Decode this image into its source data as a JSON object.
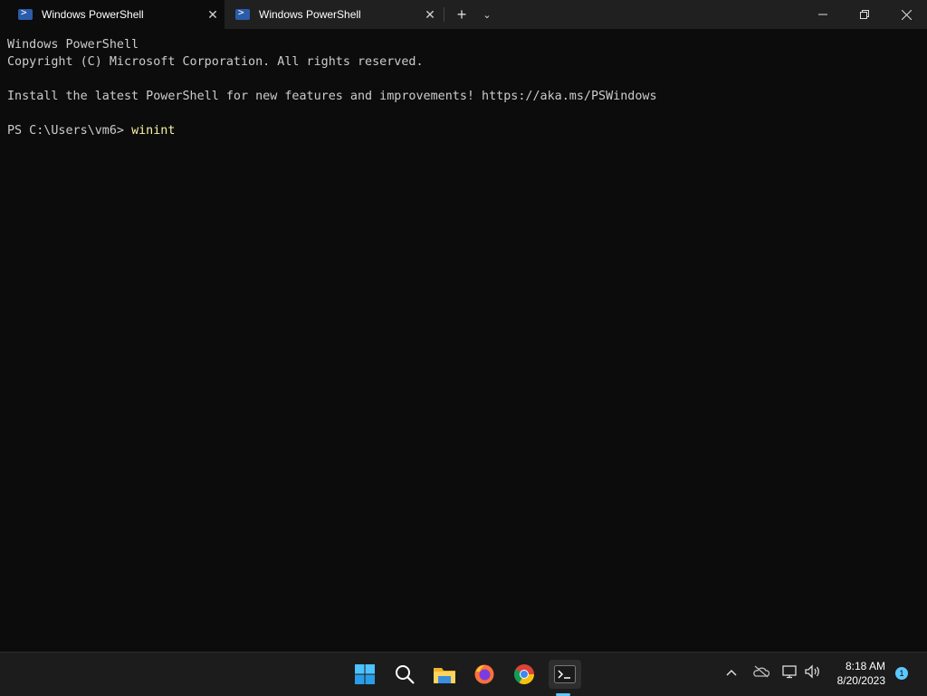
{
  "tabs": [
    {
      "label": "Windows PowerShell"
    },
    {
      "label": "Windows PowerShell"
    }
  ],
  "terminal": {
    "line1": "Windows PowerShell",
    "line2": "Copyright (C) Microsoft Corporation. All rights reserved.",
    "line3": "Install the latest PowerShell for new features and improvements! https://aka.ms/PSWindows",
    "prompt": "PS C:\\Users\\vm6> ",
    "command": "winint"
  },
  "clock": {
    "time": "8:18 AM",
    "date": "8/20/2023"
  },
  "notifications": {
    "count": "1"
  },
  "colors": {
    "accent": "#5cc8ff",
    "background": "#0c0c0c"
  }
}
